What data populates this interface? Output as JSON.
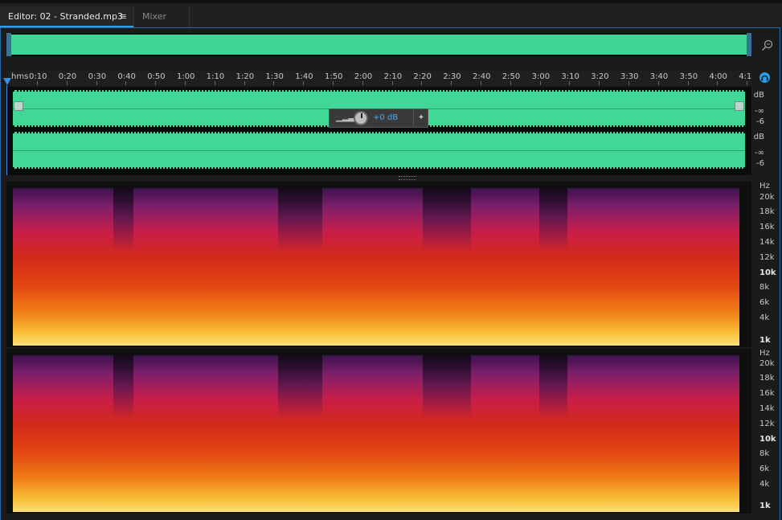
{
  "tabs": {
    "editor_label": "Editor: 02 - Stranded.mp3",
    "editor_menu": "≡",
    "mixer_label": "Mixer"
  },
  "ruler": {
    "unit": "hms",
    "labels": [
      "0:10",
      "0:20",
      "0:30",
      "0:40",
      "0:50",
      "1:00",
      "1:10",
      "1:20",
      "1:30",
      "1:40",
      "1:50",
      "2:00",
      "2:10",
      "2:20",
      "2:30",
      "2:40",
      "2:50",
      "3:00",
      "3:10",
      "3:20",
      "3:30",
      "3:40",
      "3:50",
      "4:00",
      "4:1"
    ]
  },
  "hud": {
    "value": "+0 dB"
  },
  "channels": {
    "ch1": {
      "db_top": "dB",
      "db_inf": "-∞",
      "db_6": "-6"
    },
    "ch2": {
      "db_top": "dB",
      "db_inf": "-∞",
      "db_6": "-6"
    }
  },
  "spectral": {
    "unit": "Hz",
    "labels": [
      "20k",
      "18k",
      "16k",
      "14k",
      "12k",
      "10k",
      "8k",
      "6k",
      "4k",
      "1k"
    ]
  },
  "colors": {
    "waveform": "#40d797",
    "accent": "#2e9be6"
  },
  "icons": {
    "zoom": "zoom-icon",
    "headphones": "headphones-icon",
    "pin": "pin-icon",
    "volume": "volume-bars-icon",
    "knob": "knob-icon"
  }
}
